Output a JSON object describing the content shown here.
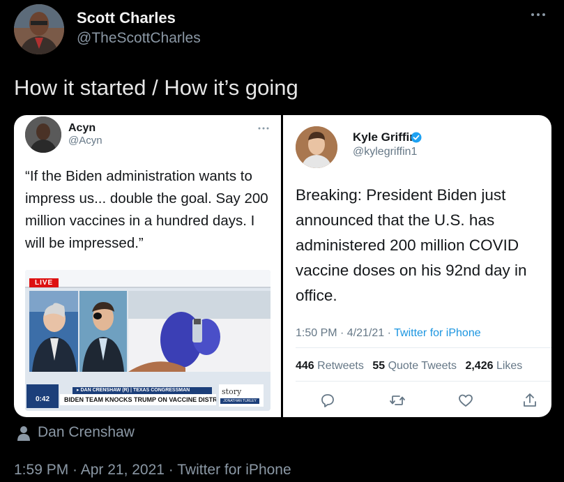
{
  "tweet": {
    "author_name": "Scott Charles",
    "author_handle": "@TheScottCharles",
    "text": "How it started / How it’s going",
    "media_credit": "Dan Crenshaw",
    "timestamp": "1:59 PM · Apr 21, 2021 · Twitter for iPhone",
    "more_icon": "more-horizontal-icon"
  },
  "left_card": {
    "name": "Acyn",
    "handle": "@Acyn",
    "body": "“If the Biden administration wants to impress us... double the goal. Say 200 million vaccines in a hundred days. I will be impressed.”",
    "video": {
      "live_label": "LIVE",
      "fox_label": "0:42",
      "chyron_top": "▸ DAN CRENSHAW (R) | TEXAS CONGRESSMAN",
      "chyron_main": "BIDEN TEAM KNOCKS TRUMP ON VACCINE DISTRIBUTION",
      "story_label": "story",
      "story_sub": "JONATHAN TURLEY"
    }
  },
  "right_card": {
    "name": "Kyle Griffin",
    "handle": "@kylegriffin1",
    "body": "Breaking: President Biden just announced that the U.S. has administered 200 million COVID vaccine doses on his 92nd day in office.",
    "time": "1:50 PM · 4/21/21 · ",
    "source": "Twitter for iPhone",
    "retweets_count": "446",
    "retweets_label": "Retweets",
    "quotes_count": "55",
    "quotes_label": "Quote Tweets",
    "likes_count": "2,426",
    "likes_label": "Likes",
    "accent": "#1b95e0"
  }
}
